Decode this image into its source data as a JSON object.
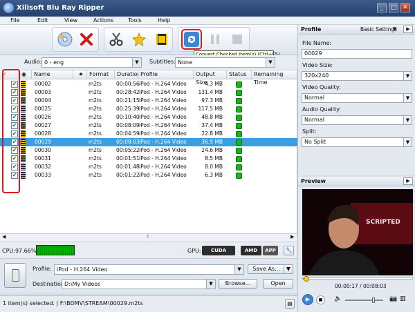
{
  "window": {
    "title": "Xilisoft Blu Ray Ripper",
    "minimize": "_",
    "maximize": "□",
    "close": "✕"
  },
  "menu": [
    "File",
    "Edit",
    "View",
    "Actions",
    "Tools",
    "Help"
  ],
  "toolbar": {
    "tooltip": "Convert Checked Item(s) (Ctrl+F5)"
  },
  "audio": {
    "label": "Audio:",
    "value": "0 - eng"
  },
  "subtitles": {
    "label": "Subtitles:",
    "value": "None"
  },
  "columns": [
    "Name",
    "★",
    "Format",
    "Duration",
    "Profile",
    "Output Size",
    "Status",
    "Remaining Time"
  ],
  "rows": [
    {
      "name": "00002",
      "format": "m2ts",
      "duration": "00:00:56",
      "profile": "iPod - H.264 Video",
      "size": "4.3 MB"
    },
    {
      "name": "00003",
      "format": "m2ts",
      "duration": "00:28:42",
      "profile": "iPod - H.264 Video",
      "size": "131.4 MB"
    },
    {
      "name": "00004",
      "format": "m2ts",
      "duration": "00:21:15",
      "profile": "iPod - H.264 Video",
      "size": "97.3 MB"
    },
    {
      "name": "00025",
      "format": "m2ts",
      "duration": "00:25:39",
      "profile": "iPod - H.264 Video",
      "size": "117.5 MB"
    },
    {
      "name": "00026",
      "format": "m2ts",
      "duration": "00:10:40",
      "profile": "iPod - H.264 Video",
      "size": "48.8 MB"
    },
    {
      "name": "00027",
      "format": "m2ts",
      "duration": "00:08:09",
      "profile": "iPod - H.264 Video",
      "size": "37.4 MB"
    },
    {
      "name": "00028",
      "format": "m2ts",
      "duration": "00:04:59",
      "profile": "iPod - H.264 Video",
      "size": "22.8 MB"
    },
    {
      "name": "00029",
      "format": "m2ts",
      "duration": "00:08:03",
      "profile": "iPod - H.264 Video",
      "size": "36.9 MB",
      "selected": true
    },
    {
      "name": "00030",
      "format": "m2ts",
      "duration": "00:05:22",
      "profile": "iPod - H.264 Video",
      "size": "24.6 MB"
    },
    {
      "name": "00031",
      "format": "m2ts",
      "duration": "00:01:51",
      "profile": "iPod - H.264 Video",
      "size": "8.5 MB"
    },
    {
      "name": "00032",
      "format": "m2ts",
      "duration": "00:01:48",
      "profile": "iPod - H.264 Video",
      "size": "8.0 MB"
    },
    {
      "name": "00033",
      "format": "m2ts",
      "duration": "00:01:22",
      "profile": "iPod - H.264 Video",
      "size": "6.3 MB"
    }
  ],
  "cpu": {
    "label": "CPU:97.66%"
  },
  "gpu": {
    "label": "GPU:",
    "cuda": "CUDA",
    "amd": "AMD",
    "app": "APP"
  },
  "profile": {
    "label": "Profile:",
    "value": "iPod - H.264 Video",
    "save_as": "Save As..."
  },
  "destination": {
    "label": "Destination:",
    "value": "D:\\My Videos",
    "browse": "Browse...",
    "open": "Open"
  },
  "statusbar": {
    "text": "1 item(s) selected. | F:\\BDMV\\STREAM\\00029.m2ts"
  },
  "right": {
    "profile_title": "Profile",
    "basic_settings": "Basic Settings",
    "file_name_label": "File Name:",
    "file_name": "00029",
    "video_size_label": "Video Size:",
    "video_size": "320x240",
    "video_quality_label": "Video Quality:",
    "video_quality": "Normal",
    "audio_quality_label": "Audio Quality:",
    "audio_quality": "Normal",
    "split_label": "Split:",
    "split": "No Split"
  },
  "preview": {
    "title": "Preview",
    "time": "00:00:17 / 00:08:03",
    "overlay_text": "SCRIPTED",
    "progress": 0.035,
    "volume": 0.75
  },
  "colors": {
    "selected_row": "#3b9ee0",
    "status_ok": "#19b719",
    "highlight": "#e0141b"
  }
}
